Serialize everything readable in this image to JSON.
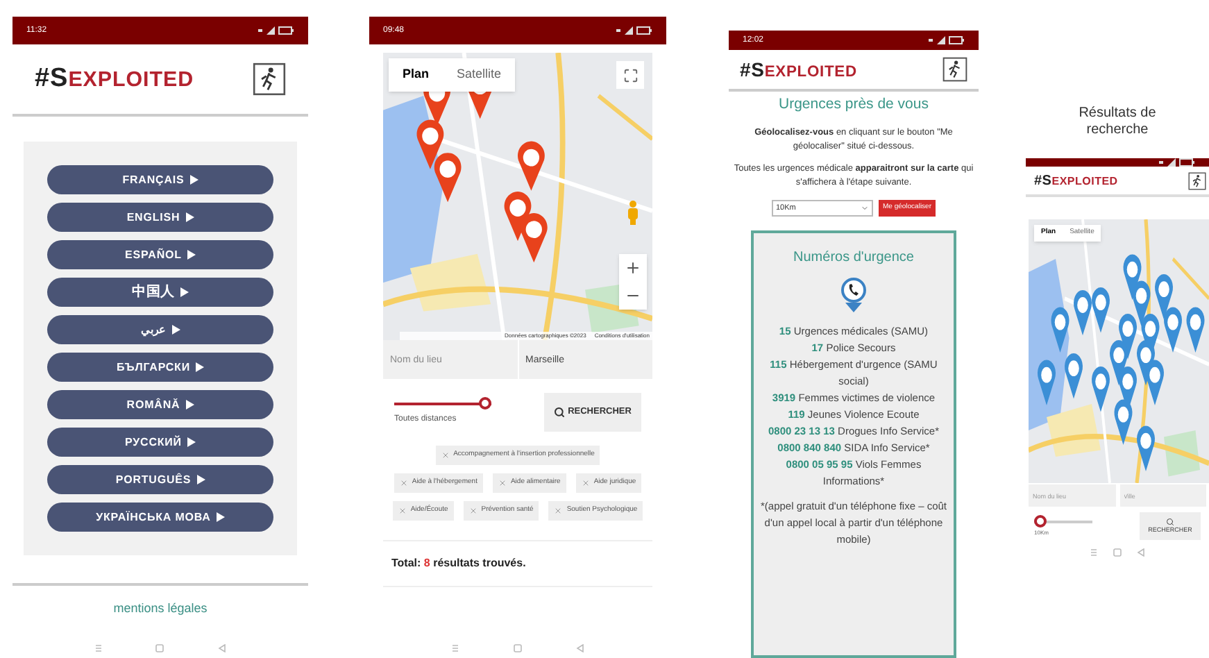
{
  "language_screen": {
    "status_time": "11:32",
    "logo": {
      "lead": "#S",
      "rest": "EXPLOITED"
    },
    "languages": [
      "FRANÇAIS",
      "ENGLISH",
      "ESPAÑOL",
      "中国人",
      "عربي",
      "БЪЛГАРСКИ",
      "ROMÂNĂ",
      "РУССКИЙ",
      "PORTUGUÊS",
      "УКРАЇНСЬКА МОВА"
    ],
    "footer_link": "mentions légales"
  },
  "map_screen": {
    "status_time": "09:48",
    "map_type": [
      {
        "label": "Plan",
        "selected": true
      },
      {
        "label": "Satellite",
        "selected": false
      }
    ],
    "attribution": [
      "Données cartographiques ©2023",
      "Conditions d'utilisation"
    ],
    "place_field": {
      "placeholder": "Nom du lieu"
    },
    "city_field": {
      "value": "Marseille"
    },
    "distance": {
      "level": 1,
      "reading": "Toutes distances"
    },
    "search_button": "RECHERCHER",
    "filters": [
      "Accompagnement à l'insertion professionnelle",
      "Aide à l'hébergement",
      "Aide alimentaire",
      "Aide juridique",
      "Aide/Écoute",
      "Prévention santé",
      "Soutien Psychologique"
    ],
    "total": {
      "label": "Total:",
      "count": "8",
      "rest": "résultats trouvés."
    }
  },
  "emergency_screen": {
    "status_time": "12:02",
    "logo": {
      "lead": "#S",
      "rest": "EXPLOITED"
    },
    "title": "Urgences près de vous",
    "paragraphs": [
      "**Géolocalisez-vous** en cliquant sur le bouton \"Me géolocaliser\" situé ci-dessous.",
      "Toutes les urgences médicale **apparaitront sur la carte** qui s'affichera à l'étape suivante."
    ],
    "radius_select": {
      "value": "10Km"
    },
    "locate_button": "Me géolocaliser",
    "card_title": "Numéros d'urgence",
    "numbers": [
      {
        "number": "15",
        "label": "Urgences médicales (SAMU)"
      },
      {
        "number": "17",
        "label": "Police Secours"
      },
      {
        "number": "115",
        "label": "Hébergement d'urgence (SAMU social)"
      },
      {
        "number": "3919",
        "label": "Femmes victimes de violence"
      },
      {
        "number": "119",
        "label": "Jeunes Violence Ecoute"
      },
      {
        "number": "0800 23 13 13",
        "label": "Drogues Info Service*"
      },
      {
        "number": "0800 840 840",
        "label": "SIDA Info Service*"
      },
      {
        "number": "0800 05 95 95",
        "label": "Viols Femmes Informations*"
      }
    ],
    "footnote": "*(appel gratuit d'un téléphone fixe – coût d'un appel local à partir d'un téléphone mobile)"
  },
  "results_screen": {
    "heading": "Résultats de recherche",
    "logo": {
      "lead": "#S",
      "rest": "EXPLOITED"
    },
    "map_type": [
      {
        "label": "Plan",
        "selected": true
      },
      {
        "label": "Satellite",
        "selected": false
      }
    ],
    "place_field": {
      "placeholder": "Nom du lieu"
    },
    "city_field": {
      "placeholder": "Ville"
    },
    "distance": {
      "level": 0,
      "reading": "10Km"
    },
    "search_button": "RECHERCHER"
  }
}
